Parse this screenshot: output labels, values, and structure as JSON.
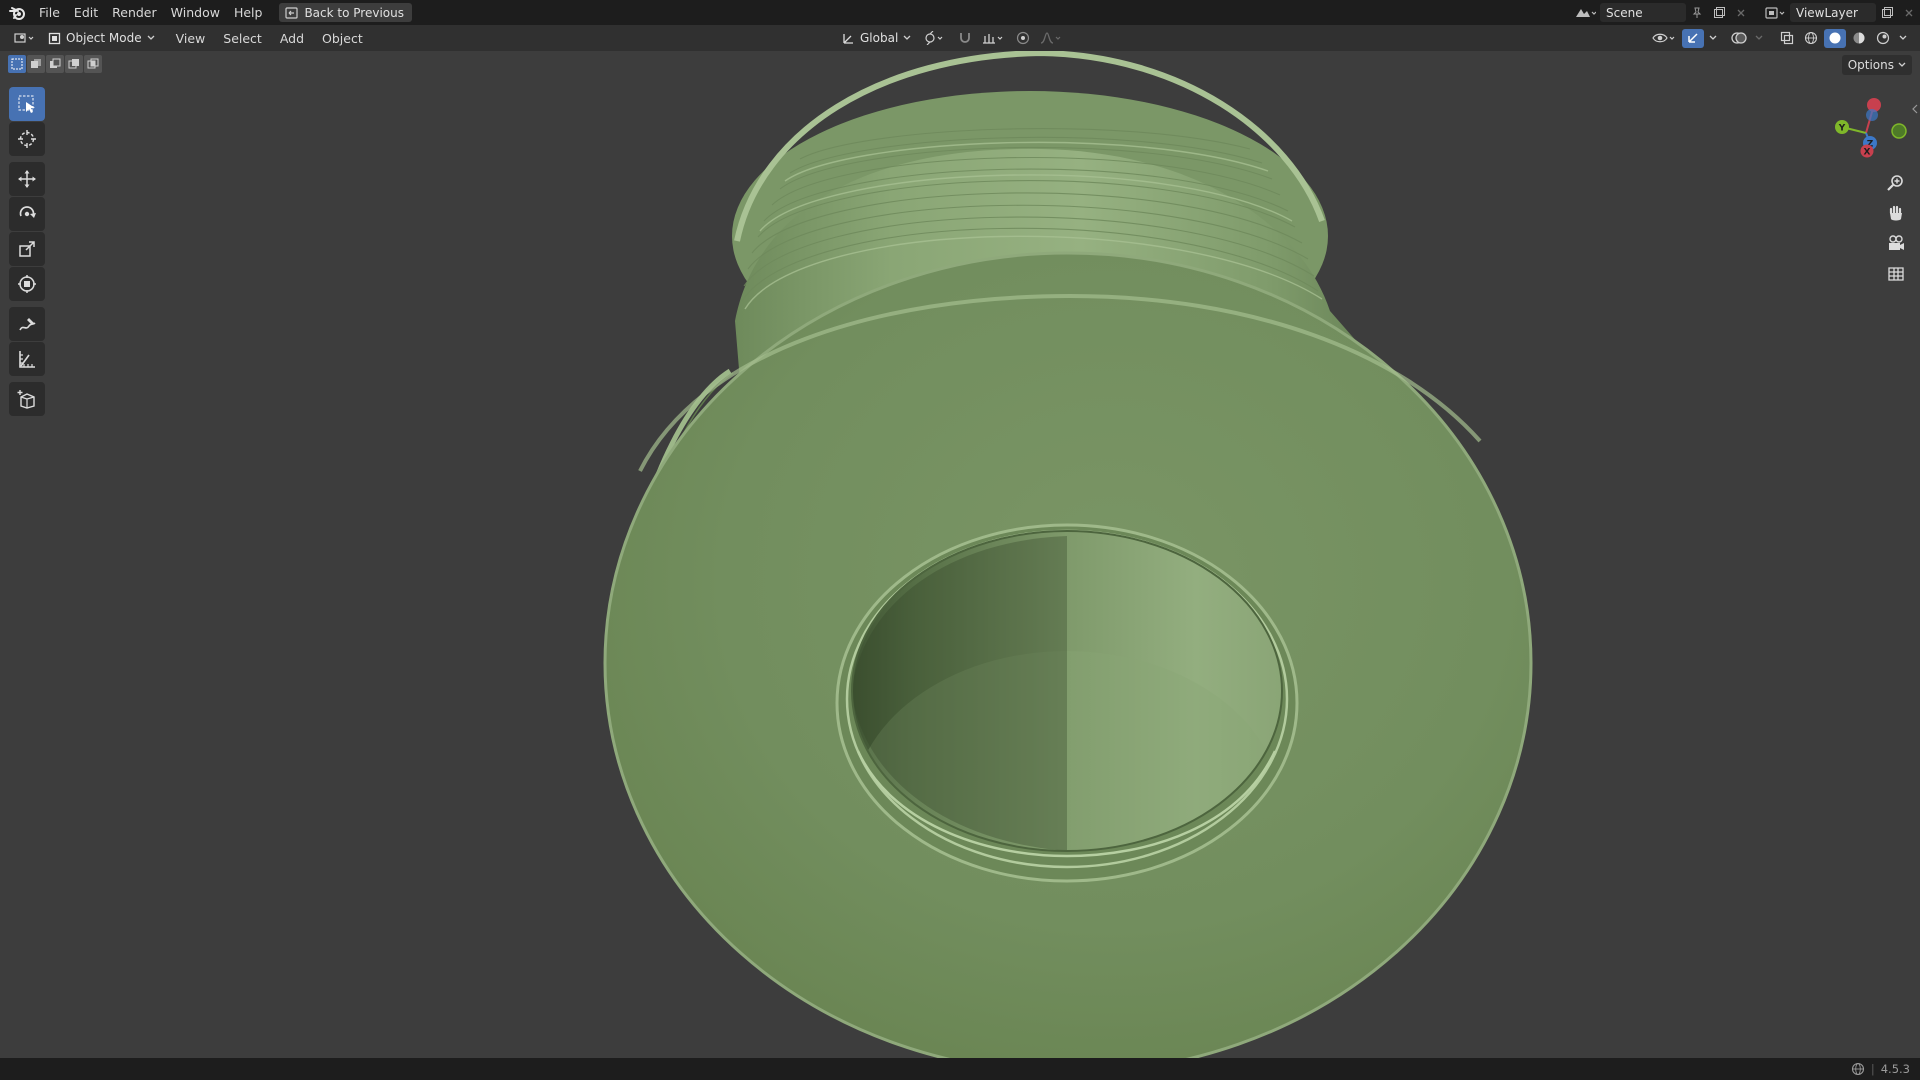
{
  "topbar": {
    "menus": [
      "File",
      "Edit",
      "Render",
      "Window",
      "Help"
    ],
    "back_button": "Back to Previous",
    "scene_name": "Scene",
    "view_layer": "ViewLayer"
  },
  "header": {
    "mode": "Object Mode",
    "menus": [
      "View",
      "Select",
      "Add",
      "Object"
    ],
    "transform_orientation": "Global"
  },
  "viewport": {
    "options_label": "Options",
    "gizmo_axes": {
      "x": "X",
      "y": "Y",
      "z": "Z"
    },
    "object_color": "#7d9a68"
  },
  "toolbar": {
    "tools": [
      "select-box",
      "cursor",
      "move",
      "rotate",
      "scale",
      "transform",
      "annotate",
      "measure",
      "add-cube"
    ],
    "active_tool": "select-box"
  },
  "colors": {
    "accent": "#4772b3",
    "background": "#3d3d3d",
    "topbar": "#1d1d1d"
  },
  "statusbar": {
    "version": "4.5.3"
  }
}
